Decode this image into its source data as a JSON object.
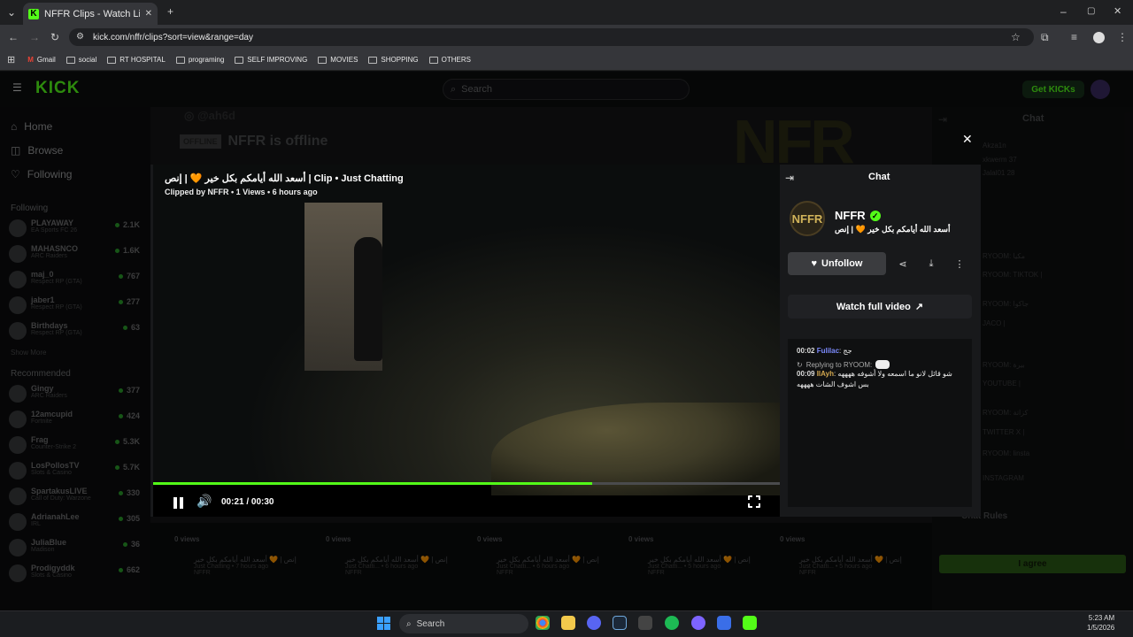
{
  "browser": {
    "tab_title": "NFFR Clips - Watch Live on",
    "url": "kick.com/nffr/clips?sort=view&range=day",
    "bookmarks": [
      "Gmail",
      "social",
      "RT HOSPITAL",
      "programing",
      "SELF IMPROVING",
      "MOVIES",
      "SHOPPING",
      "OTHERS"
    ]
  },
  "kick": {
    "logo": "KICK",
    "search_placeholder": "Search",
    "get_kicks": "Get KICKs",
    "nav": {
      "home": "Home",
      "browse": "Browse",
      "following": "Following"
    },
    "following_label": "Following",
    "recommended_label": "Recommended",
    "show_more": "Show More",
    "following_channels": [
      {
        "name": "PLAYAWAY",
        "sub": "EA Sports FC 26",
        "count": "2.1K"
      },
      {
        "name": "MAHASNCO",
        "sub": "ARC Raiders",
        "count": "1.6K"
      },
      {
        "name": "maj_0",
        "sub": "Respect RP (GTA)",
        "count": "767"
      },
      {
        "name": "jaber1",
        "sub": "Respect RP (GTA)",
        "count": "277"
      },
      {
        "name": "Birthdays",
        "sub": "Respect RP (GTA)",
        "count": "63"
      }
    ],
    "recommended_channels": [
      {
        "name": "Gingy",
        "sub": "ARC Raiders",
        "count": "377"
      },
      {
        "name": "12amcupid",
        "sub": "Fortnite",
        "count": "424"
      },
      {
        "name": "Frag",
        "sub": "Counter-Strike 2",
        "count": "5.3K"
      },
      {
        "name": "LosPollosTV",
        "sub": "Slots & Casino",
        "count": "5.7K"
      },
      {
        "name": "SpartakusLIVE",
        "sub": "Call of Duty: Warzone",
        "count": "330"
      },
      {
        "name": "AdrianahLee",
        "sub": "IRL",
        "count": "305"
      },
      {
        "name": "JuliaBlue",
        "sub": "Madison",
        "count": "36"
      },
      {
        "name": "Prodigyddk",
        "sub": "Slots & Casino",
        "count": "662"
      }
    ],
    "offline_badge": "OFFLINE",
    "offline_text": "NFFR is offline",
    "bg_chat_title": "Chat",
    "bg_chat_lines": [
      "Akza1n",
      "xkwerm 37",
      "Jalal01 28",
      "RYOOM: مكيا",
      "RYOOM: TIKTOK |",
      "RYOOM: جاكوا",
      "JACO |",
      "RYOOM: بيرة",
      "YOUTUBE |",
      "RYOOM: كزاتة",
      "TWITTER X |",
      "RYOOM: linsta",
      "INSTAGRAM"
    ],
    "chat_rules": "Chat Rules",
    "i_agree": "I agree",
    "clips_row": [
      {
        "views": "0 views",
        "title": "إنص | 🧡 أسعد الله أيامكم بكل خير",
        "meta": "Just Chatting • 7 hours ago",
        "author": "NFFR"
      },
      {
        "views": "0 views",
        "title": "إنص | 🧡 أسعد الله أيامكم بكل خير",
        "meta": "Just Chatti... • 6 hours ago",
        "author": "NFFR"
      },
      {
        "views": "0 views",
        "title": "إنص | 🧡 أسعد الله أيامكم بكل خير",
        "meta": "Just Chatti... • 6 hours ago",
        "author": "NFFR"
      },
      {
        "views": "0 views",
        "title": "إنص | 🧡 أسعد الله أيامكم بكل خير",
        "meta": "Just Chatti... • 5 hours ago",
        "author": "NFFR"
      },
      {
        "views": "0 views",
        "title": "إنص | 🧡 أسعد الله أيامكم بكل خير",
        "meta": "Just Chatti... • 5 hours ago",
        "author": "NFFR"
      }
    ]
  },
  "modal": {
    "clip_title": "أسعد الله أيامكم بكل خير 🧡 | إنص | Clip • Just Chatting",
    "clip_meta": "Clipped by NFFR • 1 Views • 6 hours ago",
    "time": "00:21 / 00:30",
    "progress": 0.7,
    "side_title": "Chat",
    "channel_name": "NFFR",
    "channel_avatar": "NFFR",
    "channel_subtitle": "أسعد الله أيامكم بكل خير 🧡 | إنص",
    "unfollow": "Unfollow",
    "watch_full": "Watch full video",
    "chat": [
      {
        "time": "00:02",
        "user": "Fulilac",
        "user_color": "#7d8cff",
        "text": "جج"
      },
      {
        "reply_to": "Replying to RYOOM:",
        "time": "00:09",
        "user": "IlAyh",
        "user_color": "#d4a84f",
        "text": "شو قائل لانو ما اسمعه ولا أشوفه ههههه بس اشوف الشات ههههه"
      }
    ]
  },
  "taskbar": {
    "search": "Search",
    "time": "5:23 AM",
    "date": "1/5/2026"
  },
  "colors": {
    "accent": "#53fc18"
  }
}
